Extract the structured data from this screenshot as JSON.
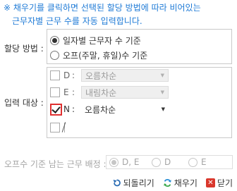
{
  "notice": {
    "line1": "※ 채우기를 클릭하면 선택된 할당 방법에 따라 비어있는",
    "line2": "근무자별 근무 수를 자동 입력합니다."
  },
  "allocation": {
    "label": "할당 방법 :",
    "options": [
      {
        "label": "일자별 근무자 수 기준",
        "selected": true
      },
      {
        "label": "오프(주말, 휴일)수 기준",
        "selected": false
      }
    ]
  },
  "input_target": {
    "label": "입력 대상 :",
    "rows": [
      {
        "letter": "D",
        "checked": false,
        "enabled": false,
        "sort": "오름차순"
      },
      {
        "letter": "E",
        "checked": false,
        "enabled": false,
        "sort": "내림차순"
      },
      {
        "letter": "N",
        "checked": true,
        "enabled": true,
        "sort": "오름차순"
      },
      {
        "letter": "",
        "checked": false,
        "enabled": false,
        "sort": ""
      }
    ]
  },
  "off_assign": {
    "label": "오프수 기준 남는 근무 배정 :",
    "options": [
      {
        "label": "D, E",
        "selected": true
      },
      {
        "label": "D",
        "selected": false
      },
      {
        "label": "E",
        "selected": false
      }
    ]
  },
  "footer": {
    "undo_label": "되돌리기",
    "fill_label": "채우기",
    "close_label": "닫기"
  },
  "colors": {
    "notice": "#1e7ad6",
    "highlight_border": "#e03030",
    "close_icon": "#d9372c"
  }
}
